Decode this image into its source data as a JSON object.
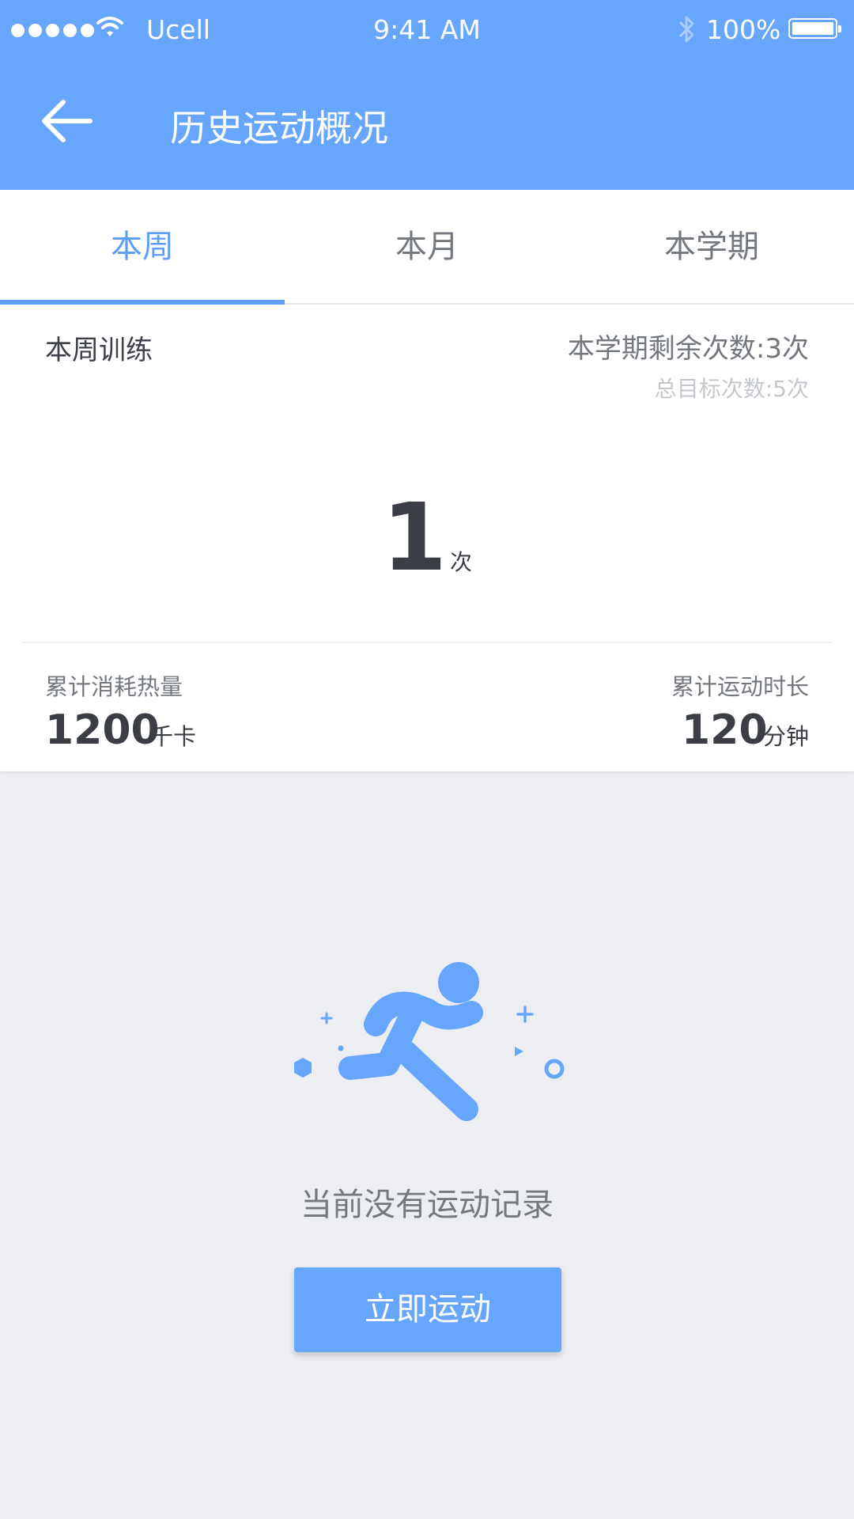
{
  "status_bar": {
    "carrier": "Ucell",
    "time": "9:41 AM",
    "battery": "100%",
    "icons": [
      "signal-dots-icon",
      "wifi-icon",
      "bluetooth-icon",
      "battery-icon"
    ]
  },
  "header": {
    "back_icon": "arrow-left-icon",
    "title": "历史运动概况"
  },
  "tabs": [
    {
      "label": "本周",
      "active": true
    },
    {
      "label": "本月",
      "active": false
    },
    {
      "label": "本学期",
      "active": false
    }
  ],
  "summary": {
    "label": "本周训练",
    "remaining": "本学期剩余次数:3次",
    "target": "总目标次数:5次",
    "count": "1",
    "count_unit": "次",
    "calories": {
      "label": "累计消耗热量",
      "value": "1200",
      "unit": "千卡"
    },
    "duration": {
      "label": "累计运动时长",
      "value": "120",
      "unit": "分钟"
    }
  },
  "empty_state": {
    "icon": "running-person-icon",
    "message": "当前没有运动记录",
    "button_label": "立即运动"
  },
  "colors": {
    "primary": "#66a6fd",
    "tab_active": "#5d9ff8",
    "background": "#eceef2"
  }
}
